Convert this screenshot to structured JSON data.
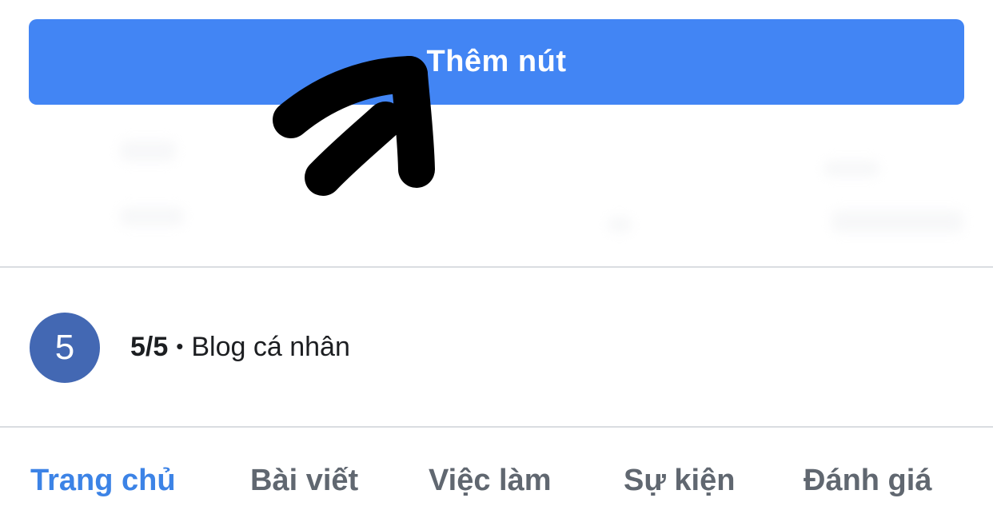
{
  "colors": {
    "accent": "#4285f4",
    "rating_circle": "#4368b3",
    "tab_active": "#3c83e6",
    "tab_inactive": "#606770",
    "annotation_stroke": "#000000"
  },
  "header_button": {
    "label": "Thêm nút"
  },
  "rating": {
    "circle_value": "5",
    "score": "5/5",
    "separator": "•",
    "category": "Blog cá nhân"
  },
  "tabs": [
    {
      "label": "Trang chủ",
      "active": true
    },
    {
      "label": "Bài viết",
      "active": false
    },
    {
      "label": "Việc làm",
      "active": false
    },
    {
      "label": "Sự kiện",
      "active": false
    },
    {
      "label": "Đánh giá",
      "active": false
    }
  ],
  "annotation": {
    "icon": "hand-drawn-arrow-icon"
  }
}
